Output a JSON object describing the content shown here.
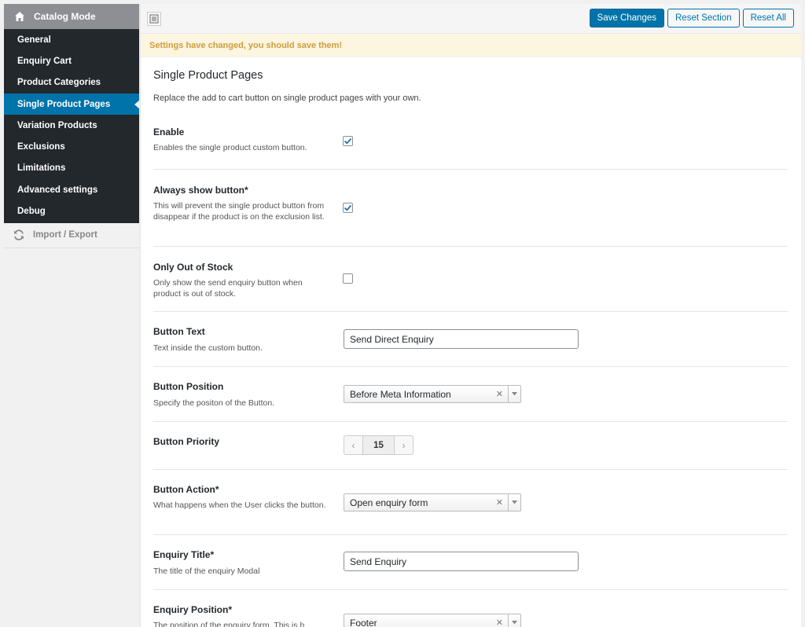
{
  "sidebar": {
    "header": {
      "title": "Catalog Mode",
      "icon": "home-icon"
    },
    "items": [
      {
        "label": "General"
      },
      {
        "label": "Enquiry Cart"
      },
      {
        "label": "Product Categories"
      },
      {
        "label": "Single Product Pages",
        "active": true
      },
      {
        "label": "Variation Products"
      },
      {
        "label": "Exclusions"
      },
      {
        "label": "Limitations"
      },
      {
        "label": "Advanced settings"
      },
      {
        "label": "Debug"
      }
    ],
    "import_export": {
      "label": "Import / Export",
      "icon": "refresh-icon"
    }
  },
  "toolbar": {
    "save_label": "Save Changes",
    "reset_section_label": "Reset Section",
    "reset_all_label": "Reset All"
  },
  "notice": {
    "text": "Settings have changed, you should save them!"
  },
  "section": {
    "title": "Single Product Pages",
    "description": "Replace the add to cart button on single product pages with your own."
  },
  "fields": {
    "enable": {
      "label": "Enable",
      "desc": "Enables the single product custom button.",
      "checked": true
    },
    "always_show": {
      "label": "Always show button*",
      "desc": "This will prevent the single product button from disappear if the product is on the exclusion list.",
      "checked": true
    },
    "out_of_stock": {
      "label": "Only Out of Stock",
      "desc": "Only show the send enquiry button when product is out of stock.",
      "checked": false
    },
    "button_text": {
      "label": "Button Text",
      "desc": "Text inside the custom button.",
      "value": "Send Direct Enquiry"
    },
    "button_position": {
      "label": "Button Position",
      "desc": "Specify the positon of the Button.",
      "value": "Before Meta Information"
    },
    "button_priority": {
      "label": "Button Priority",
      "value": "15"
    },
    "button_action": {
      "label": "Button Action*",
      "desc": "What happens when the User clicks the button.",
      "value": "Open enquiry form"
    },
    "enquiry_title": {
      "label": "Enquiry Title*",
      "desc": "The title of the enquiry Modal",
      "value": "Send Enquiry"
    },
    "enquiry_position": {
      "label": "Enquiry Position*",
      "desc": "The position of the enquiry form. This is h",
      "value": "Footer"
    }
  },
  "colors": {
    "accent": "#0073aa",
    "sidebar_bg": "#23282d",
    "notice_text": "#cf9d3d"
  }
}
